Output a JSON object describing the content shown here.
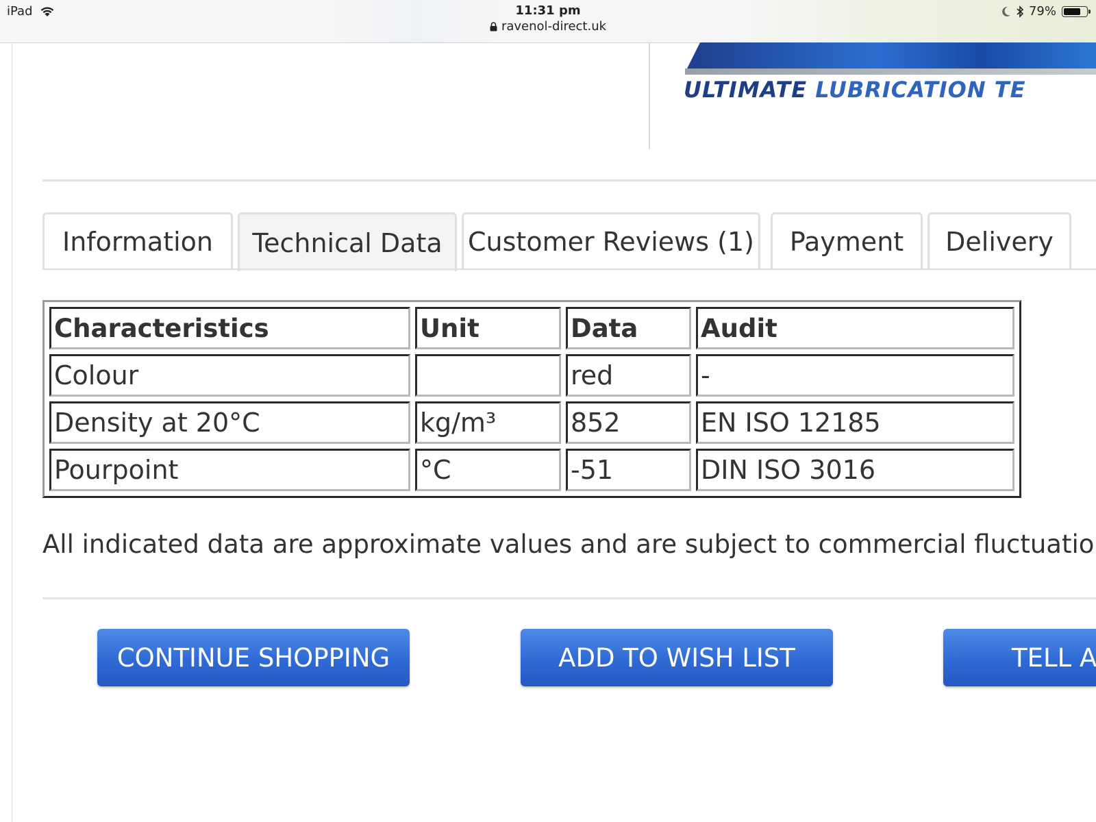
{
  "status_bar": {
    "device": "iPad",
    "time": "11:31 pm",
    "url": "ravenol-direct.uk",
    "battery_text": "79%",
    "battery_level": 0.79,
    "icons": [
      "wifi-icon",
      "lock-icon",
      "moon-icon",
      "bluetooth-icon",
      "battery-icon"
    ]
  },
  "logo": {
    "text_part1": "ULTIMATE ",
    "text_part2": "LUBRICATION TE",
    "colors": {
      "dark": "#1d3f86",
      "light": "#2f64bf"
    }
  },
  "tabs": [
    {
      "label": "Information",
      "active": false
    },
    {
      "label": "Technical Data",
      "active": true
    },
    {
      "label": "Customer Reviews (1)",
      "active": false
    },
    {
      "label": "Payment",
      "active": false
    },
    {
      "label": "Delivery",
      "active": false
    }
  ],
  "table": {
    "headers": [
      "Characteristics",
      "Unit",
      "Data",
      "Audit"
    ],
    "rows": [
      [
        "Colour",
        "",
        "red",
        "-"
      ],
      [
        "Density at 20°C",
        "kg/m³",
        "852",
        "EN ISO 12185"
      ],
      [
        "Pourpoint",
        "°C",
        "-51",
        "DIN ISO 3016"
      ]
    ]
  },
  "note": "All indicated data are approximate values and are subject to commercial fluctuations.",
  "buttons": {
    "continue_shopping": "CONTINUE SHOPPING",
    "add_to_wish_list": "ADD TO WISH LIST",
    "tell_a_friend": "TELL A",
    "color": "#2f6ad4"
  }
}
